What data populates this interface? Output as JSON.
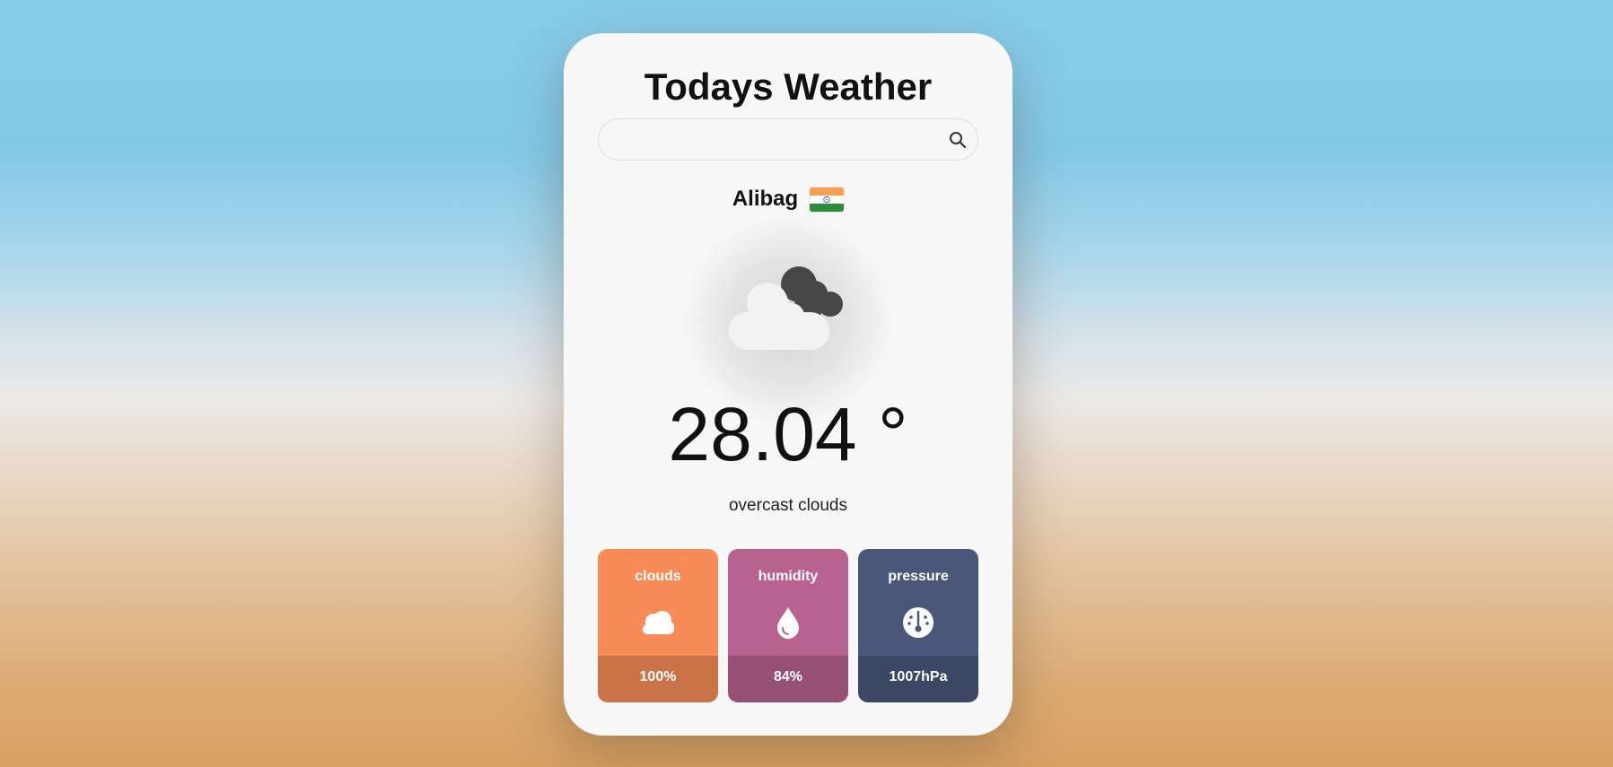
{
  "app": {
    "title": "Todays Weather"
  },
  "search": {
    "placeholder": "",
    "value": "",
    "icon": "search-icon"
  },
  "location": {
    "city": "Alibag",
    "country_flag": "india-flag-icon"
  },
  "current": {
    "icon": "overcast-clouds-icon",
    "temperature": "28.04 °",
    "description": "overcast clouds"
  },
  "stats": [
    {
      "label": "clouds",
      "icon": "cloud-icon",
      "value": "100%",
      "color": "#f78c58"
    },
    {
      "label": "humidity",
      "icon": "droplet-icon",
      "value": "84%",
      "color": "#b8628f"
    },
    {
      "label": "pressure",
      "icon": "gauge-icon",
      "value": "1007hPa",
      "color": "#4a577b"
    }
  ],
  "colors": {
    "card_bg": "#f7f7f7",
    "sky_top": "#87cdea",
    "sand_bottom": "#d7a163"
  }
}
